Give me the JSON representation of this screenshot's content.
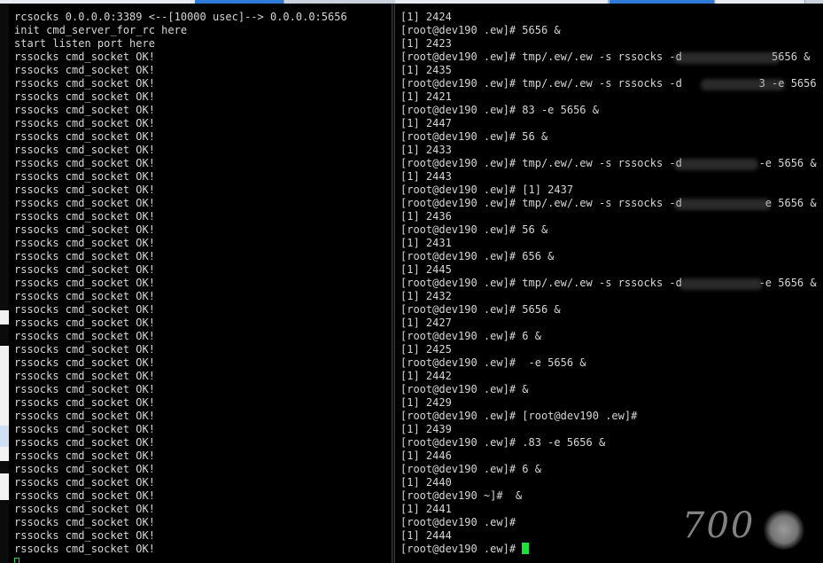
{
  "left_terminal": {
    "lines": [
      "rcsocks 0.0.0.0:3389 <--[10000 usec]--> 0.0.0.0:5656",
      "init cmd_server_for_rc here",
      "start listen port here",
      "rssocks cmd_socket OK!",
      "rssocks cmd_socket OK!",
      "rssocks cmd_socket OK!",
      "rssocks cmd_socket OK!",
      "rssocks cmd_socket OK!",
      "rssocks cmd_socket OK!",
      "rssocks cmd_socket OK!",
      "rssocks cmd_socket OK!",
      "rssocks cmd_socket OK!",
      "rssocks cmd_socket OK!",
      "rssocks cmd_socket OK!",
      "rssocks cmd_socket OK!",
      "rssocks cmd_socket OK!",
      "rssocks cmd_socket OK!",
      "rssocks cmd_socket OK!",
      "rssocks cmd_socket OK!",
      "rssocks cmd_socket OK!",
      "rssocks cmd_socket OK!",
      "rssocks cmd_socket OK!",
      "rssocks cmd_socket OK!",
      "rssocks cmd_socket OK!",
      "rssocks cmd_socket OK!",
      "rssocks cmd_socket OK!",
      "rssocks cmd_socket OK!",
      "rssocks cmd_socket OK!",
      "rssocks cmd_socket OK!",
      "rssocks cmd_socket OK!",
      "rssocks cmd_socket OK!",
      "rssocks cmd_socket OK!",
      "rssocks cmd_socket OK!",
      "rssocks cmd_socket OK!",
      "rssocks cmd_socket OK!",
      "rssocks cmd_socket OK!",
      "rssocks cmd_socket OK!",
      "rssocks cmd_socket OK!",
      "rssocks cmd_socket OK!",
      "rssocks cmd_socket OK!",
      "rssocks cmd_socket OK!"
    ]
  },
  "right_terminal": {
    "lines": [
      "[1] 2424",
      "[root@dev190 .ew]# 5656 &",
      "[1] 2423",
      "[root@dev190 .ew]# tmp/.ew/.ew -s rssocks -d              5656 &",
      "[1] 2435",
      "[root@dev190 .ew]# tmp/.ew/.ew -s rssocks -d            3 -e 5656 &",
      "[1] 2421",
      "[root@dev190 .ew]# 83 -e 5656 &",
      "[1] 2447",
      "[root@dev190 .ew]# 56 &",
      "[1] 2433",
      "[root@dev190 .ew]# tmp/.ew/.ew -s rssocks -d            -e 5656 &",
      "[1] 2443",
      "[root@dev190 .ew]# [1] 2437",
      "[root@dev190 .ew]# tmp/.ew/.ew -s rssocks -d             e 5656 &",
      "[1] 2436",
      "[root@dev190 .ew]# 56 &",
      "[1] 2431",
      "[root@dev190 .ew]# 656 &",
      "[1] 2445",
      "[root@dev190 .ew]# tmp/.ew/.ew -s rssocks -d            -e 5656 &",
      "[1] 2432",
      "[root@dev190 .ew]# 5656 &",
      "[1] 2427",
      "[root@dev190 .ew]# 6 &",
      "[1] 2425",
      "[root@dev190 .ew]#  -e 5656 &",
      "[1] 2442",
      "[root@dev190 .ew]# &",
      "[1] 2429",
      "[root@dev190 .ew]# [root@dev190 .ew]#",
      "[1] 2439",
      "[root@dev190 .ew]# .83 -e 5656 &",
      "[1] 2446",
      "[root@dev190 .ew]# 6 &",
      "[1] 2440",
      "[root@dev190 ~]#  &",
      "[1] 2441",
      "[root@dev190 .ew]#",
      "[1] 2444"
    ],
    "prompt": "[root@dev190 .ew]# "
  },
  "colors": {
    "terminal_bg": "#000000",
    "terminal_fg": "#d6d6d6",
    "cursor": "#1fe13a",
    "active_tab": "#2f7ad6"
  },
  "watermark_text": "700"
}
